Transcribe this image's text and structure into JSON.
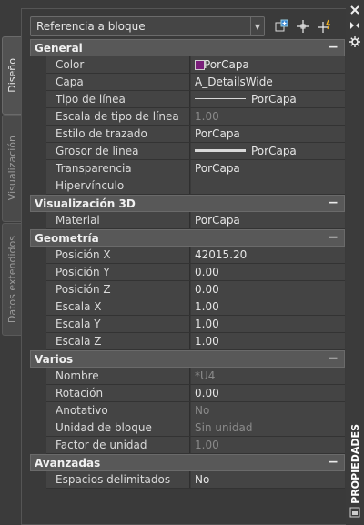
{
  "left_tabs": [
    {
      "label": "Diseño",
      "active": true
    },
    {
      "label": "Visualización",
      "active": false
    },
    {
      "label": "Datos extendidos",
      "active": false
    }
  ],
  "toolbar": {
    "object_type": "Referencia a bloque",
    "icons": [
      "toggle-pickadd-icon",
      "select-objects-icon",
      "quick-select-icon"
    ]
  },
  "right_strip": {
    "icons": [
      "close-icon",
      "autohide-icon",
      "properties-menu-icon",
      "palette-menu-icon"
    ],
    "title": "PROPIEDADES"
  },
  "sections": {
    "general": {
      "title": "General",
      "toggle": "−",
      "rows": [
        {
          "label": "Color",
          "value": "PorCapa"
        },
        {
          "label": "Capa",
          "value": "A_DetailsWide"
        },
        {
          "label": "Tipo de línea",
          "value": "PorCapa"
        },
        {
          "label": "Escala de tipo de línea",
          "value": "1.00"
        },
        {
          "label": "Estilo de trazado",
          "value": "PorCapa"
        },
        {
          "label": "Grosor de línea",
          "value": "PorCapa"
        },
        {
          "label": "Transparencia",
          "value": "PorCapa"
        },
        {
          "label": "Hipervínculo",
          "value": ""
        }
      ]
    },
    "vis3d": {
      "title": "Visualización 3D",
      "toggle": "−",
      "rows": [
        {
          "label": "Material",
          "value": "PorCapa"
        }
      ]
    },
    "geometria": {
      "title": "Geometría",
      "toggle": "−",
      "rows": [
        {
          "label": "Posición X",
          "value": "42015.20"
        },
        {
          "label": "Posición Y",
          "value": "0.00"
        },
        {
          "label": "Posición Z",
          "value": "0.00"
        },
        {
          "label": "Escala X",
          "value": "1.00"
        },
        {
          "label": "Escala Y",
          "value": "1.00"
        },
        {
          "label": "Escala Z",
          "value": "1.00"
        }
      ]
    },
    "varios": {
      "title": "Varios",
      "toggle": "−",
      "rows": [
        {
          "label": "Nombre",
          "value": "*U4"
        },
        {
          "label": "Rotación",
          "value": "0.00"
        },
        {
          "label": "Anotativo",
          "value": "No"
        },
        {
          "label": "Unidad de bloque",
          "value": "Sin unidad"
        },
        {
          "label": "Factor de unidad",
          "value": "1.00"
        }
      ]
    },
    "avanzadas": {
      "title": "Avanzadas",
      "toggle": "−",
      "rows": [
        {
          "label": "Espacios delimitados",
          "value": "No"
        }
      ]
    }
  },
  "colors": {
    "color_swatch": "#7a1e7a",
    "section_header": "#585858",
    "row_bg": "#444444"
  }
}
